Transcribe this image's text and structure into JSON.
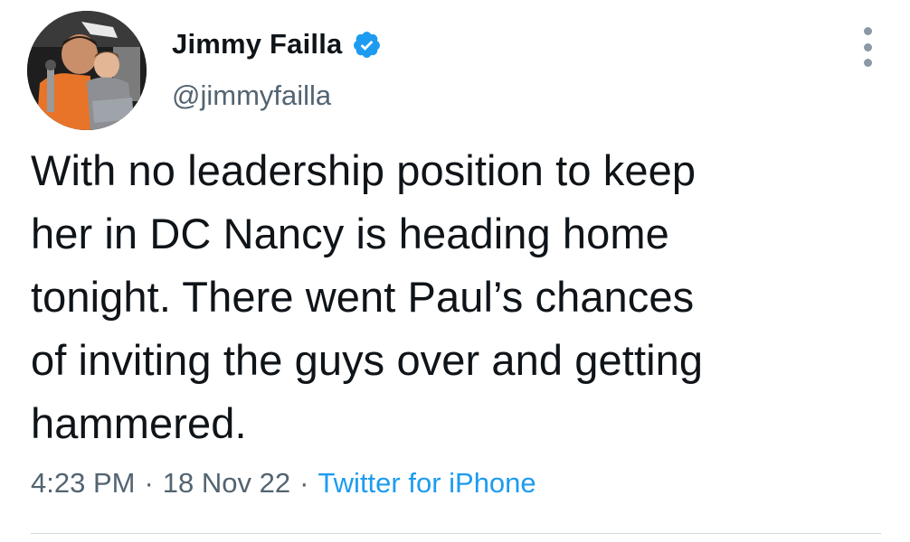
{
  "author": {
    "display_name": "Jimmy Failla",
    "handle": "@jimmyfailla",
    "verified": true,
    "verified_icon": "verified-badge-icon",
    "avatar_icon": "profile-photo"
  },
  "tweet": {
    "lines": [
      "With no leadership position to keep",
      "her in DC Nancy is heading home",
      "tonight. There went Paul’s chances",
      "of inviting the guys over and getting",
      "hammered."
    ]
  },
  "meta": {
    "time": "4:23 PM",
    "date": "18 Nov 22",
    "separator": "·",
    "source": "Twitter for iPhone"
  },
  "menu": {
    "icon": "more-options-icon"
  },
  "colors": {
    "text": "#0f1419",
    "secondary": "#536471",
    "accent": "#1d9bf0",
    "divider": "#cfd9de"
  }
}
